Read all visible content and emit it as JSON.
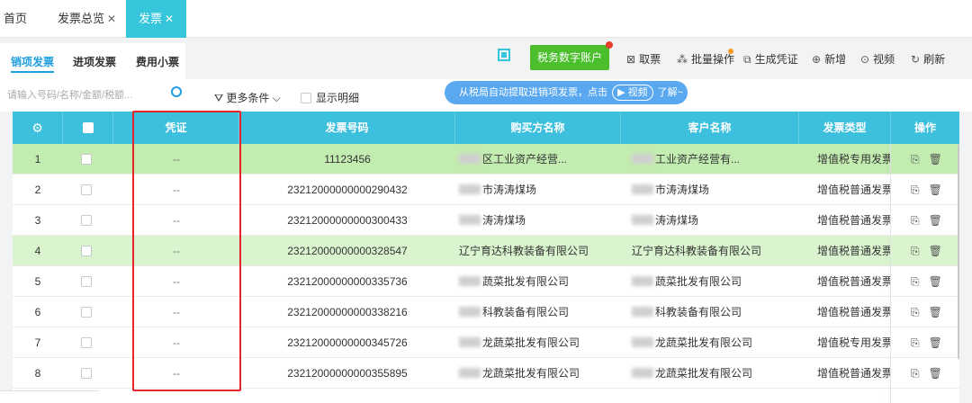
{
  "top_tabs": [
    {
      "label": "首页",
      "closable": false
    },
    {
      "label": "发票总览",
      "closable": true
    },
    {
      "label": "发票",
      "closable": true,
      "active": true
    }
  ],
  "sub_tabs": [
    {
      "label": "销项发票",
      "active": true
    },
    {
      "label": "进项发票"
    },
    {
      "label": "费用小票"
    }
  ],
  "toolbar": {
    "tax_account": "税务数字账户",
    "collect": "取票",
    "batch": "批量操作",
    "voucher": "生成凭证",
    "add": "新增",
    "video": "视频",
    "refresh": "刷新"
  },
  "filter": {
    "search_placeholder": "请输入号码/名称/金额/税额...",
    "more_conditions": "更多条件",
    "show_detail": "显示明细",
    "tip_prefix": "从税局自动提取进销项发票，点击",
    "tip_video": "视频",
    "tip_suffix": "了解~"
  },
  "table": {
    "headers": [
      "凭证",
      "发票号码",
      "购买方名称",
      "客户名称",
      "发票类型",
      "操作"
    ],
    "rows": [
      {
        "idx": "1",
        "voucher": "--",
        "number": "11123456",
        "buyer": "区工业资产经营...",
        "customer": "工业资产经营有...",
        "type": "增值税专用发票"
      },
      {
        "idx": "2",
        "voucher": "--",
        "number": "23212000000000290432",
        "buyer": "市涛涛煤场",
        "customer": "市涛涛煤场",
        "type": "增值税普通发票"
      },
      {
        "idx": "3",
        "voucher": "--",
        "number": "23212000000000300433",
        "buyer": "涛涛煤场",
        "customer": "涛涛煤场",
        "type": "增值税普通发票"
      },
      {
        "idx": "4",
        "voucher": "--",
        "number": "23212000000000328547",
        "buyer": "辽宁育达科教装备有限公司",
        "customer": "辽宁育达科教装备有限公司",
        "type": "增值税普通发票"
      },
      {
        "idx": "5",
        "voucher": "--",
        "number": "23212000000000335736",
        "buyer": "蔬菜批发有限公司",
        "customer": "蔬菜批发有限公司",
        "type": "增值税普通发票"
      },
      {
        "idx": "6",
        "voucher": "--",
        "number": "23212000000000338216",
        "buyer": "科教装备有限公司",
        "customer": "科教装备有限公司",
        "type": "增值税普通发票"
      },
      {
        "idx": "7",
        "voucher": "--",
        "number": "23212000000000345726",
        "buyer": "龙蔬菜批发有限公司",
        "customer": "龙蔬菜批发有限公司",
        "type": "增值税专用发票"
      },
      {
        "idx": "8",
        "voucher": "--",
        "number": "23212000000000355895",
        "buyer": "龙蔬菜批发有限公司",
        "customer": "龙蔬菜批发有限公司",
        "type": "增值税普通发票"
      }
    ]
  },
  "colors": {
    "header": "#3dc0dd",
    "tab_active": "#35c6dc",
    "row_highlight": "#d9f4cf",
    "highlight_box": "#e8242b",
    "tax_button": "#4bbf2b"
  }
}
